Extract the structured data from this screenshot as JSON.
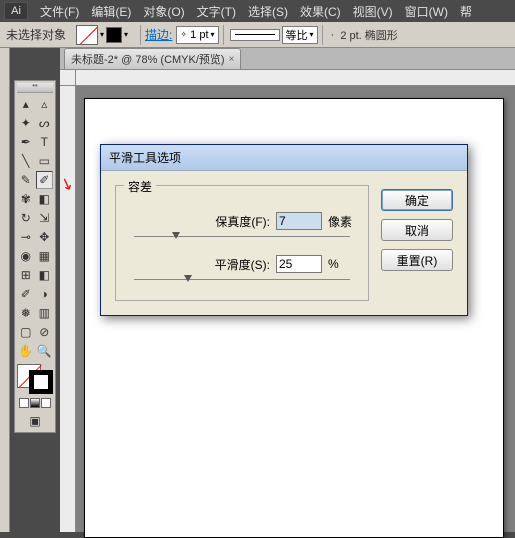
{
  "menubar": {
    "logo": "Ai",
    "items": [
      "文件(F)",
      "编辑(E)",
      "对象(O)",
      "文字(T)",
      "选择(S)",
      "效果(C)",
      "视图(V)",
      "窗口(W)",
      "帮"
    ]
  },
  "controlbar": {
    "selection_label": "未选择对象",
    "stroke_label": "描边:",
    "stroke_weight": "1 pt",
    "ratio_label": "等比",
    "point_label": "2 pt. 椭圆形"
  },
  "document": {
    "tab_title": "未标题-2* @ 78% (CMYK/预览)"
  },
  "dialog": {
    "title": "平滑工具选项",
    "fieldset_legend": "容差",
    "fidelity_label": "保真度(F):",
    "fidelity_value": "7",
    "fidelity_unit": "像素",
    "smoothness_label": "平滑度(S):",
    "smoothness_value": "25",
    "smoothness_unit": "%",
    "buttons": {
      "ok": "确定",
      "cancel": "取消",
      "reset": "重置(R)"
    }
  }
}
